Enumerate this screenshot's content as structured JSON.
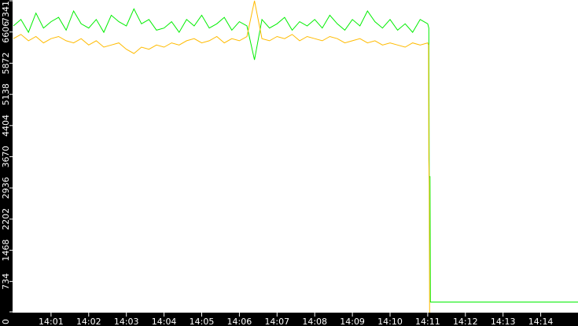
{
  "chart_data": {
    "type": "line",
    "title": "",
    "xlabel": "",
    "ylabel": "",
    "xlim": [
      0,
      15
    ],
    "ylim": [
      0,
      7341
    ],
    "grid": false,
    "x_unit": "minutes after 14:00",
    "x_ticks": [
      {
        "v": 1,
        "label": "14:01"
      },
      {
        "v": 2,
        "label": "14:02"
      },
      {
        "v": 3,
        "label": "14:03"
      },
      {
        "v": 4,
        "label": "14:04"
      },
      {
        "v": 5,
        "label": "14:05"
      },
      {
        "v": 6,
        "label": "14:06"
      },
      {
        "v": 7,
        "label": "14:07"
      },
      {
        "v": 8,
        "label": "14:08"
      },
      {
        "v": 9,
        "label": "14:09"
      },
      {
        "v": 10,
        "label": "14:10"
      },
      {
        "v": 11,
        "label": "14:11"
      },
      {
        "v": 12,
        "label": "14:12"
      },
      {
        "v": 13,
        "label": "14:13"
      },
      {
        "v": 14,
        "label": "14:14"
      }
    ],
    "y_ticks": [
      "0",
      "734",
      "1468",
      "2202",
      "2936",
      "3670",
      "4404",
      "5138",
      "5872",
      "6606",
      "7341"
    ],
    "y_tick_values": [
      0,
      734,
      1468,
      2202,
      2936,
      3670,
      4404,
      5138,
      5872,
      6606,
      7341
    ],
    "series": [
      {
        "name": "green",
        "color": "#00ee00",
        "x_start": 0,
        "x_step": 0.2,
        "values": [
          6750,
          6900,
          6600,
          7050,
          6700,
          6850,
          6950,
          6650,
          7100,
          6800,
          6700,
          6900,
          6600,
          7000,
          6850,
          6750,
          7150,
          6800,
          6900,
          6650,
          6700,
          6850,
          6600,
          6900,
          6750,
          7000,
          6700,
          6800,
          6950,
          6650,
          6850,
          6750,
          5950,
          6900,
          6700,
          6800,
          6950,
          6650,
          6850,
          6750,
          6900,
          6700,
          7000,
          6800,
          6650,
          6900,
          6750,
          7100,
          6850,
          6700,
          6900,
          6650,
          6800,
          6600,
          6900,
          6800
        ],
        "tail": [
          [
            11.03,
            6700
          ],
          [
            11.04,
            3200
          ],
          [
            11.06,
            3200
          ],
          [
            11.07,
            250
          ],
          [
            11.08,
            250
          ],
          [
            15,
            250
          ]
        ]
      },
      {
        "name": "orange",
        "color": "#ffbb00",
        "x_start": 0,
        "x_step": 0.2,
        "values": [
          6450,
          6550,
          6400,
          6500,
          6350,
          6450,
          6500,
          6400,
          6350,
          6450,
          6300,
          6400,
          6250,
          6300,
          6350,
          6200,
          6100,
          6250,
          6200,
          6300,
          6250,
          6350,
          6300,
          6400,
          6450,
          6350,
          6400,
          6500,
          6350,
          6450,
          6400,
          6500,
          7341,
          6450,
          6400,
          6500,
          6450,
          6550,
          6400,
          6500,
          6450,
          6400,
          6500,
          6450,
          6350,
          6400,
          6450,
          6350,
          6400,
          6300,
          6350,
          6300,
          6250,
          6350,
          6300,
          6350
        ],
        "tail": [
          [
            11.02,
            6300
          ],
          [
            11.03,
            3600
          ],
          [
            11.04,
            3000
          ],
          [
            11.05,
            0
          ]
        ]
      }
    ]
  }
}
